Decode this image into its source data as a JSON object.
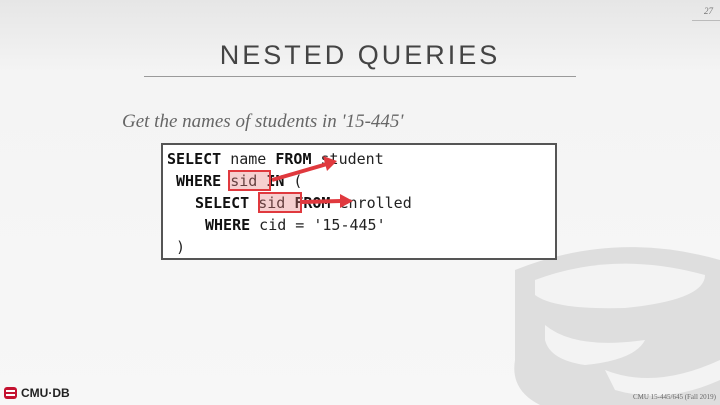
{
  "slide": {
    "page_number": "27",
    "title": "NESTED QUERIES",
    "subtitle": "Get the names of students in '15-445'"
  },
  "code": {
    "line1_kw1": "SELECT",
    "line1_a": " name ",
    "line1_kw2": "FROM",
    "line1_b": " student",
    "line2_kw1": "WHERE",
    "line2_hl": "sid",
    "line2_kw2": "IN",
    "line2_b": " (",
    "line3_kw1": "SELECT",
    "line3_hl": "sid",
    "line3_kw2": "FROM",
    "line3_b": " enrolled",
    "line4_kw1": "WHERE",
    "line4_b": " cid = '15-445'",
    "line5": ")"
  },
  "colors": {
    "highlight": "#e0393e",
    "arrow": "#e0393e"
  },
  "footer": {
    "logo_text": "CMU·DB",
    "course": "CMU 15-445/645 (Fall 2019)"
  }
}
